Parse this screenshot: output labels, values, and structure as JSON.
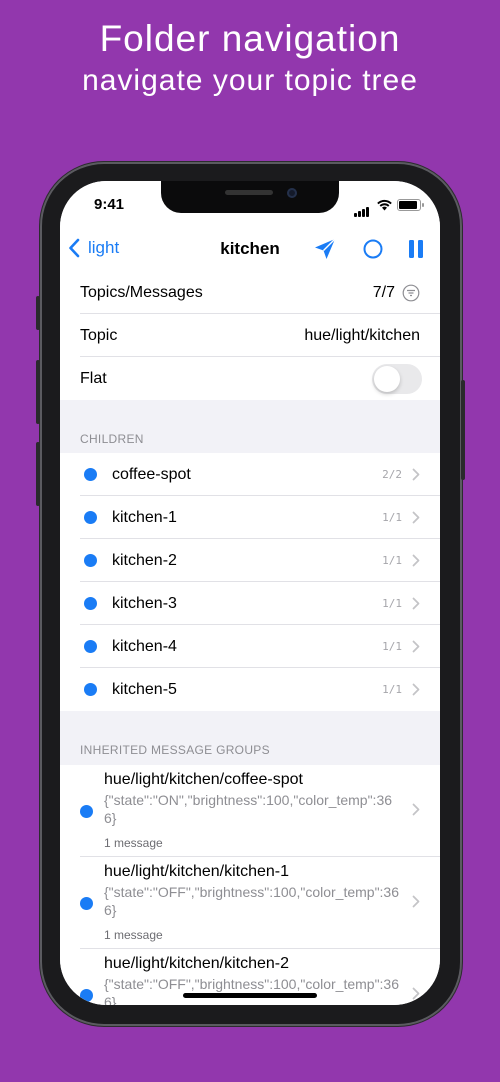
{
  "caption": {
    "title": "Folder navigation",
    "subtitle": "navigate your topic tree"
  },
  "status_bar": {
    "time": "9:41"
  },
  "nav": {
    "back_label": "light",
    "title": "kitchen"
  },
  "info": {
    "topics_messages_label": "Topics/Messages",
    "topics_messages_value": "7/7",
    "topic_label": "Topic",
    "topic_value": "hue/light/kitchen",
    "flat_label": "Flat",
    "flat_on": false
  },
  "children": {
    "header": "CHILDREN",
    "items": [
      {
        "name": "coffee-spot",
        "count": "2/2"
      },
      {
        "name": "kitchen-1",
        "count": "1/1"
      },
      {
        "name": "kitchen-2",
        "count": "1/1"
      },
      {
        "name": "kitchen-3",
        "count": "1/1"
      },
      {
        "name": "kitchen-4",
        "count": "1/1"
      },
      {
        "name": "kitchen-5",
        "count": "1/1"
      }
    ]
  },
  "groups": {
    "header": "INHERITED MESSAGE GROUPS",
    "items": [
      {
        "topic": "hue/light/kitchen/coffee-spot",
        "payload": "{\"state\":\"ON\",\"brightness\":100,\"color_temp\":366}",
        "count": "1 message"
      },
      {
        "topic": "hue/light/kitchen/kitchen-1",
        "payload": "{\"state\":\"OFF\",\"brightness\":100,\"color_temp\":366}",
        "count": "1 message"
      },
      {
        "topic": "hue/light/kitchen/kitchen-2",
        "payload": "{\"state\":\"OFF\",\"brightness\":100,\"color_temp\":366}",
        "count": ""
      }
    ]
  },
  "colors": {
    "accent": "#1a7cf5",
    "background": "#9237ad"
  }
}
